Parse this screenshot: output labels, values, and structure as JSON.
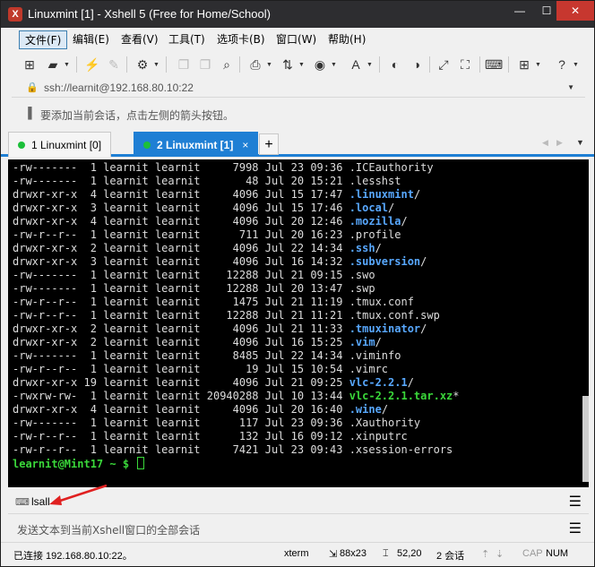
{
  "window": {
    "title": "Linuxmint [1] - Xshell 5 (Free for Home/School)",
    "app_icon": "X",
    "minimize": "—",
    "maximize": "☐",
    "close": "✕"
  },
  "menu": [
    {
      "label": "文件(F)"
    },
    {
      "label": "编辑(E)"
    },
    {
      "label": "查看(V)"
    },
    {
      "label": "工具(T)"
    },
    {
      "label": "选项卡(B)"
    },
    {
      "label": "窗口(W)"
    },
    {
      "label": "帮助(H)"
    }
  ],
  "address": {
    "value": "ssh://learnit@192.168.80.10:22"
  },
  "hint": {
    "text": "要添加当前会话，点击左侧的箭头按钮。"
  },
  "tabs": [
    {
      "label": "1 Linuxmint [0]"
    },
    {
      "label": "2 Linuxmint [1]"
    }
  ],
  "tab_close": "×",
  "tab_add": "+",
  "terminal": {
    "lines": [
      {
        "perm": "-rw-------",
        "links": " 1",
        "user": "learnit",
        "group": "learnit",
        "size": "    7998",
        "date": "Jul 23 09:36",
        "name": ".ICEauthority",
        "kind": "file"
      },
      {
        "perm": "-rw-------",
        "links": " 1",
        "user": "learnit",
        "group": "learnit",
        "size": "      48",
        "date": "Jul 20 15:21",
        "name": ".lesshst",
        "kind": "file"
      },
      {
        "perm": "drwxr-xr-x",
        "links": " 4",
        "user": "learnit",
        "group": "learnit",
        "size": "    4096",
        "date": "Jul 15 17:47",
        "name": ".linuxmint",
        "kind": "dir"
      },
      {
        "perm": "drwxr-xr-x",
        "links": " 3",
        "user": "learnit",
        "group": "learnit",
        "size": "    4096",
        "date": "Jul 15 17:46",
        "name": ".local",
        "kind": "dir"
      },
      {
        "perm": "drwxr-xr-x",
        "links": " 4",
        "user": "learnit",
        "group": "learnit",
        "size": "    4096",
        "date": "Jul 20 12:46",
        "name": ".mozilla",
        "kind": "dir"
      },
      {
        "perm": "-rw-r--r--",
        "links": " 1",
        "user": "learnit",
        "group": "learnit",
        "size": "     711",
        "date": "Jul 20 16:23",
        "name": ".profile",
        "kind": "file"
      },
      {
        "perm": "drwxr-xr-x",
        "links": " 2",
        "user": "learnit",
        "group": "learnit",
        "size": "    4096",
        "date": "Jul 22 14:34",
        "name": ".ssh",
        "kind": "dir"
      },
      {
        "perm": "drwxr-xr-x",
        "links": " 3",
        "user": "learnit",
        "group": "learnit",
        "size": "    4096",
        "date": "Jul 16 14:32",
        "name": ".subversion",
        "kind": "dir"
      },
      {
        "perm": "-rw-------",
        "links": " 1",
        "user": "learnit",
        "group": "learnit",
        "size": "   12288",
        "date": "Jul 21 09:15",
        "name": ".swo",
        "kind": "file"
      },
      {
        "perm": "-rw-------",
        "links": " 1",
        "user": "learnit",
        "group": "learnit",
        "size": "   12288",
        "date": "Jul 20 13:47",
        "name": ".swp",
        "kind": "file"
      },
      {
        "perm": "-rw-r--r--",
        "links": " 1",
        "user": "learnit",
        "group": "learnit",
        "size": "    1475",
        "date": "Jul 21 11:19",
        "name": ".tmux.conf",
        "kind": "file"
      },
      {
        "perm": "-rw-r--r--",
        "links": " 1",
        "user": "learnit",
        "group": "learnit",
        "size": "   12288",
        "date": "Jul 21 11:21",
        "name": ".tmux.conf.swp",
        "kind": "file"
      },
      {
        "perm": "drwxr-xr-x",
        "links": " 2",
        "user": "learnit",
        "group": "learnit",
        "size": "    4096",
        "date": "Jul 21 11:33",
        "name": ".tmuxinator",
        "kind": "dir"
      },
      {
        "perm": "drwxr-xr-x",
        "links": " 2",
        "user": "learnit",
        "group": "learnit",
        "size": "    4096",
        "date": "Jul 16 15:25",
        "name": ".vim",
        "kind": "dir"
      },
      {
        "perm": "-rw-------",
        "links": " 1",
        "user": "learnit",
        "group": "learnit",
        "size": "    8485",
        "date": "Jul 22 14:34",
        "name": ".viminfo",
        "kind": "file"
      },
      {
        "perm": "-rw-r--r--",
        "links": " 1",
        "user": "learnit",
        "group": "learnit",
        "size": "      19",
        "date": "Jul 15 10:54",
        "name": ".vimrc",
        "kind": "file"
      },
      {
        "perm": "drwxr-xr-x",
        "links": "19",
        "user": "learnit",
        "group": "learnit",
        "size": "    4096",
        "date": "Jul 21 09:25",
        "name": "vlc-2.2.1",
        "kind": "dir"
      },
      {
        "perm": "-rwxrw-rw-",
        "links": " 1",
        "user": "learnit",
        "group": "learnit",
        "size": "20940288",
        "date": "Jul 10 13:44",
        "name": "vlc-2.2.1.tar.xz",
        "kind": "exec"
      },
      {
        "perm": "drwxr-xr-x",
        "links": " 4",
        "user": "learnit",
        "group": "learnit",
        "size": "    4096",
        "date": "Jul 20 16:40",
        "name": ".wine",
        "kind": "dir"
      },
      {
        "perm": "-rw-------",
        "links": " 1",
        "user": "learnit",
        "group": "learnit",
        "size": "     117",
        "date": "Jul 23 09:36",
        "name": ".Xauthority",
        "kind": "file"
      },
      {
        "perm": "-rw-r--r--",
        "links": " 1",
        "user": "learnit",
        "group": "learnit",
        "size": "     132",
        "date": "Jul 16 09:12",
        "name": ".xinputrc",
        "kind": "file"
      },
      {
        "perm": "-rw-r--r--",
        "links": " 1",
        "user": "learnit",
        "group": "learnit",
        "size": "    7421",
        "date": "Jul 23 09:43",
        "name": ".xsession-errors",
        "kind": "file"
      }
    ],
    "prompt": "learnit@Mint17 ~ $",
    "colors": {
      "dir": "#58a8ff",
      "exec": "#3ad83a",
      "text": "#dddddd",
      "bg": "#000000"
    }
  },
  "command_bar": {
    "label": "lsall"
  },
  "send_bar": {
    "placeholder": "发送文本到当前Xshell窗口的全部会话"
  },
  "status": {
    "connection": "已连接 192.168.80.10:22。",
    "term_type": "xterm",
    "size": "88x23",
    "cursor_pos": "52,20",
    "sessions": "2 会话",
    "cap": "CAP",
    "num": "NUM"
  }
}
